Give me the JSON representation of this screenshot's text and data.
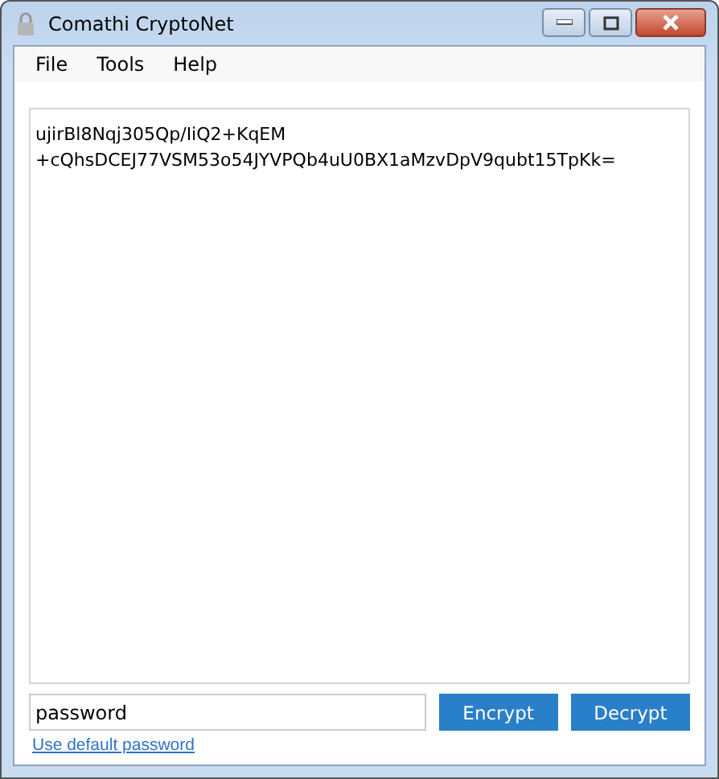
{
  "window": {
    "title": "Comathi CryptoNet"
  },
  "menu": [
    {
      "label": "File"
    },
    {
      "label": "Tools"
    },
    {
      "label": "Help"
    }
  ],
  "output": {
    "lines": [
      "ujirBl8Nqj305Qp/IiQ2+KqEM",
      "+cQhsDCEJ77VSM53o54JYVPQb4uU0BX1aMzvDpV9qubt15TpKk="
    ]
  },
  "password": {
    "value": "password"
  },
  "buttons": [
    {
      "label": "Encrypt"
    },
    {
      "label": "Decrypt"
    }
  ],
  "link": {
    "label": "Use default password"
  }
}
